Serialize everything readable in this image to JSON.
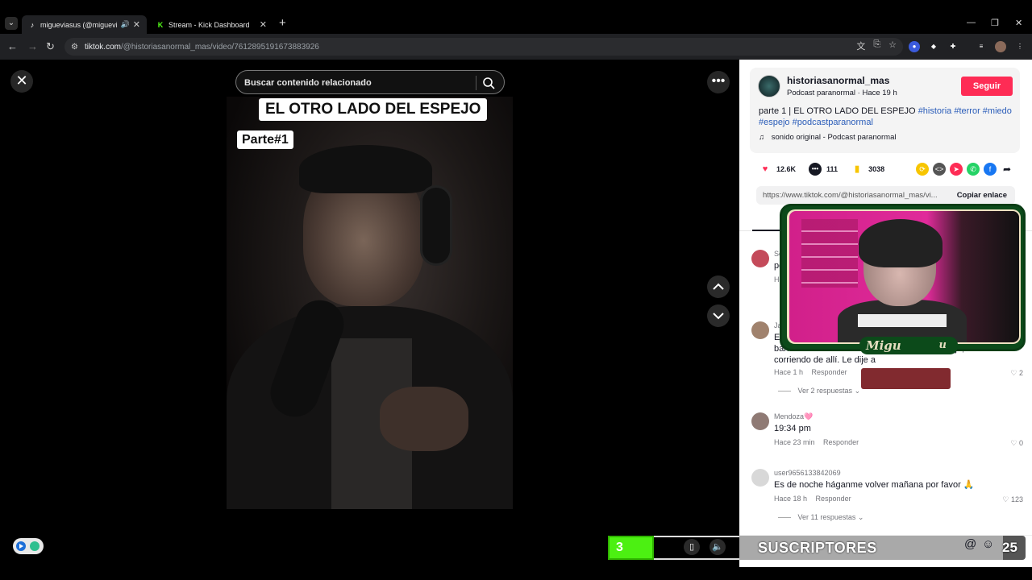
{
  "browser": {
    "tabs": [
      {
        "title": "miguevi­asus (@migueviasu",
        "favicon": "tiktok-icon"
      },
      {
        "title": "Stream - Kick Dashboard",
        "favicon": "kick-icon"
      }
    ],
    "url_host": "tiktok.com",
    "url_path": "/@historiasanormal_mas/video/7612895191673883926"
  },
  "video": {
    "search_placeholder": "Buscar contenido relacionado",
    "caption_title": "EL OTRO LADO DEL ESPEJO",
    "caption_part": "Parte#1"
  },
  "post": {
    "author": "historiasanormal_mas",
    "subtitle": "Podcast paranormal · Hace 19 h",
    "follow_label": "Seguir",
    "description": "parte 1 | EL OTRO LADO DEL ESPEJO",
    "hashtags": [
      "#historia",
      "#terror",
      "#miedo",
      "#espejo",
      "#podcastparanormal"
    ],
    "music": "sonido original - Podcast paranormal",
    "likes": "12.6K",
    "comments": "111",
    "saves": "3038",
    "link": "https://www.tiktok.com/@historiasanormal_mas/vi...",
    "copy_label": "Copiar enlace"
  },
  "comments": [
    {
      "name": "Se",
      "text": "pe",
      "time": "Ho"
    },
    {
      "name": "Ja",
      "text_line1": "Es",
      "text_line2": "baño",
      "text_line3": "corriendo de allí. Le dije a",
      "tail": "jo, sali",
      "time": "Hace 1 h",
      "reply": "Responder",
      "likes": "2",
      "more": "Ver 2 respuestas"
    },
    {
      "name": "Mendoza🩷",
      "text": "19:34 pm",
      "time": "Hace 23 min",
      "reply": "Responder",
      "likes": "0"
    },
    {
      "name": "user9656133842069",
      "text": "Es de noche háganme volver mañana por favor 🙏",
      "time": "Hace 18 h",
      "reply": "Responder",
      "likes": "123",
      "more": "Ver 11 respuestas"
    }
  ],
  "stream_overlay": {
    "counter": "3",
    "subs_label": "SUSCRIPTORES",
    "subs_count": "25",
    "cam_name": "Migu",
    "cam_name_end": "u"
  },
  "colors": {
    "follow": "#fe2c55",
    "hashtag": "#2b5db9",
    "counter_green": "#4cf012",
    "cam_frame": "#0c4a1a"
  }
}
